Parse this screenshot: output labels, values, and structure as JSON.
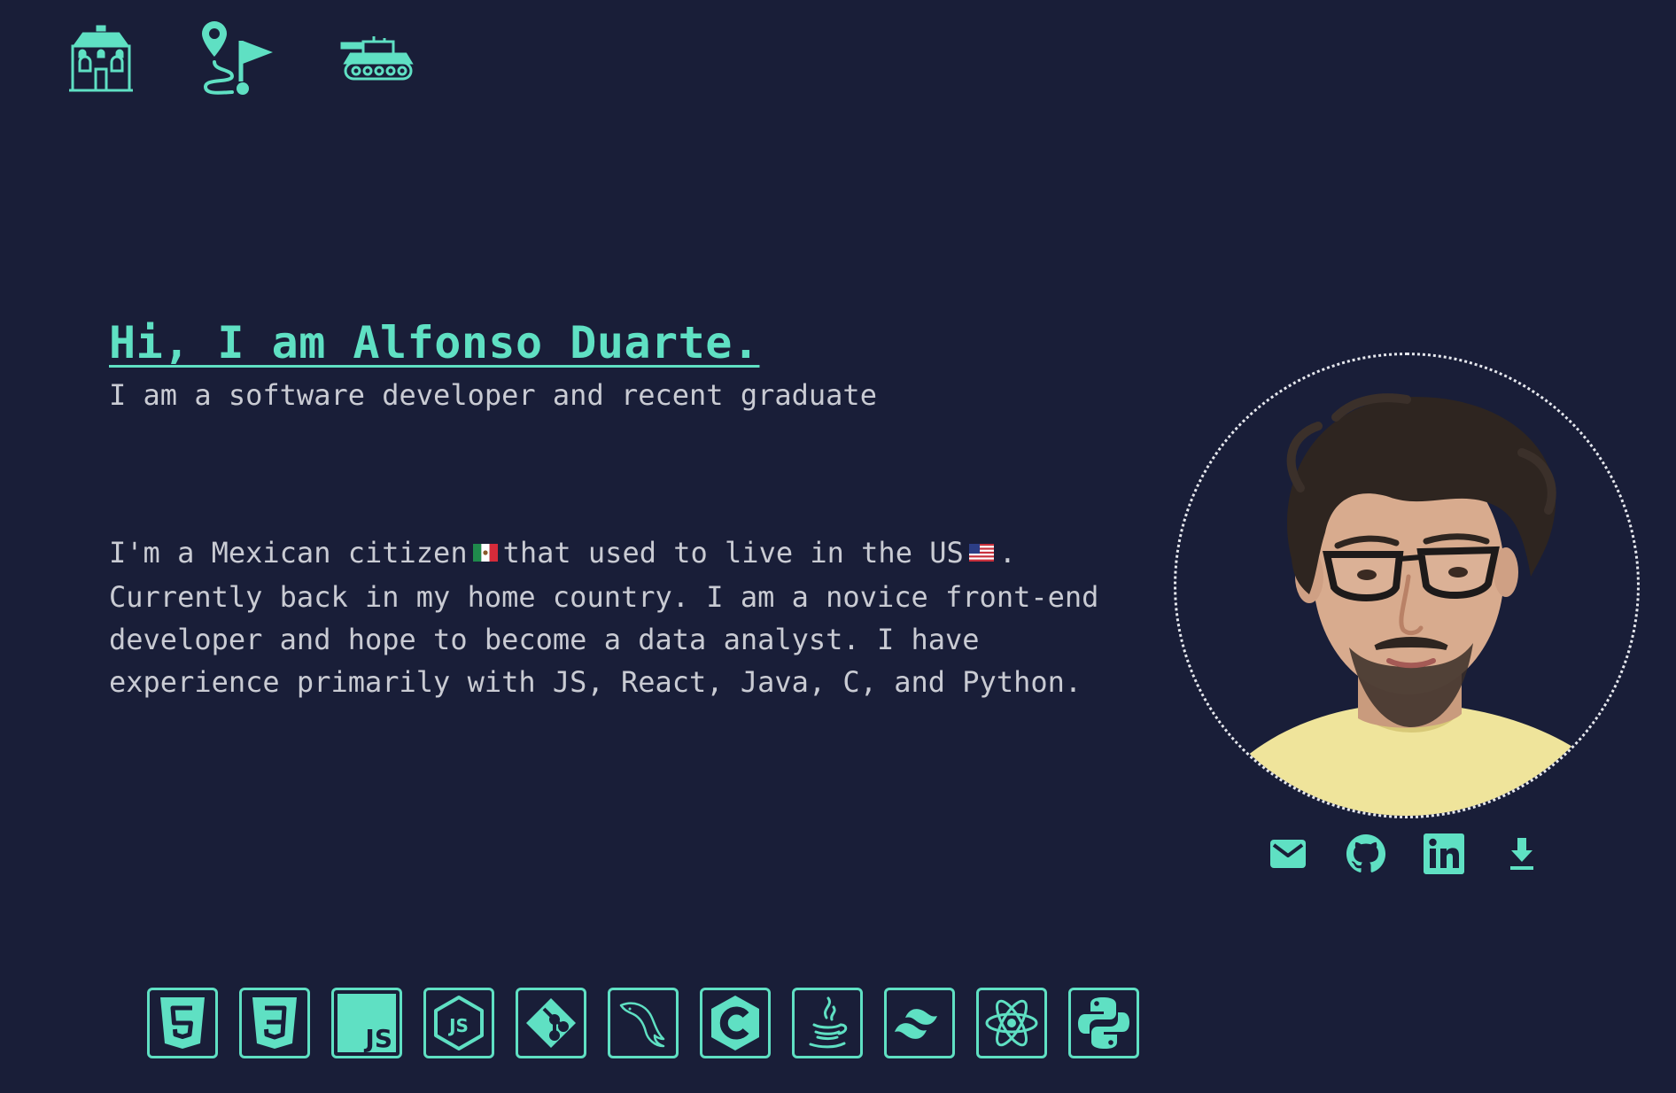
{
  "nav": {
    "items": [
      {
        "icon": "house-icon"
      },
      {
        "icon": "route-icon"
      },
      {
        "icon": "tank-icon"
      }
    ]
  },
  "hero": {
    "title": "Hi, I am Alfonso Duarte.",
    "subtitle": "I am a software developer and recent graduate"
  },
  "bio": {
    "part1": "I'm a Mexican citizen",
    "flag1": "mexico-flag-icon",
    "part2": "that used to live in the US",
    "flag2": "usa-flag-icon",
    "part3": ". Currently back in my home country. I am a novice front-end developer and hope to become a data analyst. I have experience primarily with JS, React, Java, C, and Python."
  },
  "socials": [
    "email-icon",
    "github-icon",
    "linkedin-icon",
    "download-icon"
  ],
  "skills": [
    "html5",
    "css3",
    "javascript",
    "nodejs",
    "git",
    "mysql",
    "c",
    "java",
    "tailwind",
    "react",
    "python"
  ],
  "colors": {
    "background": "#191e38",
    "accent": "#5fe0c3",
    "text": "#c9cbd3"
  }
}
